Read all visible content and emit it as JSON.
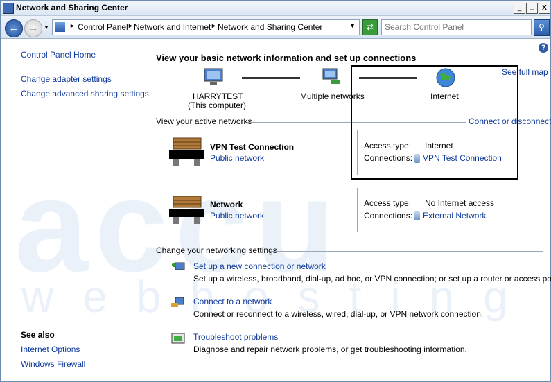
{
  "window": {
    "title": "Network and Sharing Center"
  },
  "caption_buttons": {
    "minimize": "_",
    "maximize": "□",
    "close": "X"
  },
  "address": {
    "crumb1": "Control Panel",
    "crumb2": "Network and Internet",
    "crumb3": "Network and Sharing Center"
  },
  "search": {
    "placeholder": "Search Control Panel"
  },
  "sidebar": {
    "home": "Control Panel Home",
    "adapter": "Change adapter settings",
    "sharing": "Change advanced sharing settings",
    "see_also": "See also",
    "internet_options": "Internet Options",
    "firewall": "Windows Firewall"
  },
  "main": {
    "heading": "View your basic network information and set up connections",
    "see_full_map": "See full map",
    "map": {
      "computer_name": "HARRYTEST",
      "computer_sub": "(This computer)",
      "multiple": "Multiple networks",
      "internet": "Internet"
    },
    "active_heading": "View your active networks",
    "connect_link": "Connect or disconnect",
    "networks": [
      {
        "name": "VPN Test Connection",
        "category": "Public network",
        "access_label": "Access type:",
        "access_value": "Internet",
        "conn_label": "Connections:",
        "conn_value": "VPN Test Connection"
      },
      {
        "name": "Network",
        "category": "Public network",
        "access_label": "Access type:",
        "access_value": "No Internet access",
        "conn_label": "Connections:",
        "conn_value": "External Network"
      }
    ],
    "change_heading": "Change your networking settings",
    "tasks": [
      {
        "title": "Set up a new connection or network",
        "desc": "Set up a wireless, broadband, dial-up, ad hoc, or VPN connection; or set up a router or access point."
      },
      {
        "title": "Connect to a network",
        "desc": "Connect or reconnect to a wireless, wired, dial-up, or VPN network connection."
      },
      {
        "title": "Troubleshoot problems",
        "desc": "Diagnose and repair network problems, or get troubleshooting information."
      }
    ]
  },
  "watermark": {
    "top": "accu",
    "bottom": "webhosting"
  }
}
